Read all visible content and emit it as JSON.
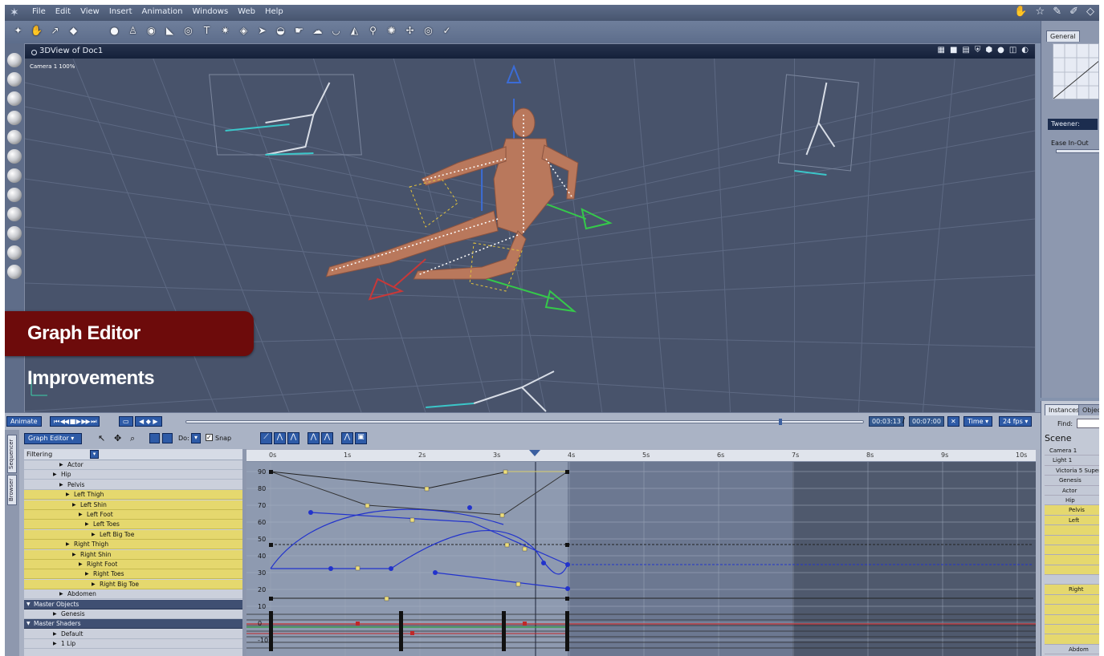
{
  "menu": {
    "items": [
      "File",
      "Edit",
      "View",
      "Insert",
      "Animation",
      "Windows",
      "Web",
      "Help"
    ]
  },
  "viewport": {
    "title": "3DView of Doc1",
    "camera_label": "Camera 1 100%"
  },
  "banner": {
    "text": "Graph Editor Improvements"
  },
  "right_panel": {
    "general_tab": "General",
    "tweener_label": "Tweener:",
    "ease_label": "Ease In-Out",
    "instances_tab": "Instances",
    "objects_tab": "Object",
    "find_label": "Find:",
    "scene_label": "Scene",
    "scene_items": [
      "Camera 1",
      "Light 1",
      "Victoria 5 Super",
      "Genesis",
      "Actor",
      "Hip",
      "Pelvis",
      "Left",
      "",
      "",
      "",
      "",
      "",
      "",
      "Right",
      "",
      "",
      "",
      "",
      "",
      "Abdom"
    ]
  },
  "transport": {
    "animate_label": "Animate",
    "current_time": "00:03:13",
    "separator": "/",
    "total_time": "00:07:00",
    "time_mode": "Time",
    "fps": "24 fps"
  },
  "sequencer": {
    "tabs": [
      "Sequencer",
      "Browser"
    ],
    "editor_select": "Graph Editor",
    "do_label": "Do:",
    "snap_label": "Snap",
    "filter_label": "Filtering"
  },
  "tree": [
    {
      "label": "Actor",
      "indent": 2,
      "selected": false,
      "header": false
    },
    {
      "label": "Hip",
      "indent": 1,
      "selected": false,
      "header": false
    },
    {
      "label": "Pelvis",
      "indent": 2,
      "selected": false,
      "header": false
    },
    {
      "label": "Left Thigh",
      "indent": 3,
      "selected": true,
      "header": false
    },
    {
      "label": "Left Shin",
      "indent": 4,
      "selected": true,
      "header": false
    },
    {
      "label": "Left Foot",
      "indent": 5,
      "selected": true,
      "header": false
    },
    {
      "label": "Left Toes",
      "indent": 6,
      "selected": true,
      "header": false
    },
    {
      "label": "Left Big Toe",
      "indent": 7,
      "selected": true,
      "header": false
    },
    {
      "label": "Right Thigh",
      "indent": 3,
      "selected": true,
      "header": false
    },
    {
      "label": "Right Shin",
      "indent": 4,
      "selected": true,
      "header": false
    },
    {
      "label": "Right Foot",
      "indent": 5,
      "selected": true,
      "header": false
    },
    {
      "label": "Right Toes",
      "indent": 6,
      "selected": true,
      "header": false
    },
    {
      "label": "Right Big Toe",
      "indent": 7,
      "selected": true,
      "header": false
    },
    {
      "label": "Abdomen",
      "indent": 2,
      "selected": false,
      "header": false
    },
    {
      "label": "Master Objects",
      "indent": 0,
      "selected": false,
      "header": true
    },
    {
      "label": "Genesis",
      "indent": 1,
      "selected": false,
      "header": false
    },
    {
      "label": "Master Shaders",
      "indent": 0,
      "selected": false,
      "header": true
    },
    {
      "label": "Default",
      "indent": 1,
      "selected": false,
      "header": false
    },
    {
      "label": "1 Lip",
      "indent": 1,
      "selected": false,
      "header": false
    }
  ],
  "ruler": {
    "labels": [
      "0s",
      "1s",
      "2s",
      "3s",
      "4s",
      "5s",
      "6s",
      "7s",
      "8s",
      "9s",
      "10s"
    ]
  },
  "graph": {
    "y_labels": [
      "90",
      "80",
      "70",
      "60",
      "50",
      "40",
      "30",
      "20",
      "10",
      "0",
      "-10"
    ]
  },
  "colors": {
    "selected_row": "#e5d86e",
    "graph_curve": "#2233cc",
    "header_bg": "#3f4f72"
  }
}
